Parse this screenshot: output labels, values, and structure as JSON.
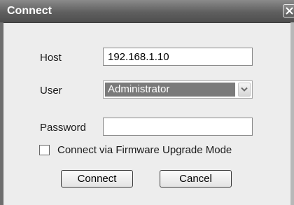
{
  "dialog": {
    "title": "Connect",
    "host_label": "Host",
    "host_value": "192.168.1.10",
    "user_label": "User",
    "user_selected": "Administrator",
    "password_label": "Password",
    "password_value": "",
    "firmware_mode_label": "Connect via Firmware Upgrade Mode",
    "firmware_mode_checked": false,
    "connect_button": "Connect",
    "cancel_button": "Cancel"
  },
  "icons": {
    "close": "close-icon",
    "dropdown": "chevron-down-icon"
  },
  "colors": {
    "titlebar": "#5f5f5f",
    "background": "#ededed",
    "selected_user_bg": "#7a7a7a"
  }
}
